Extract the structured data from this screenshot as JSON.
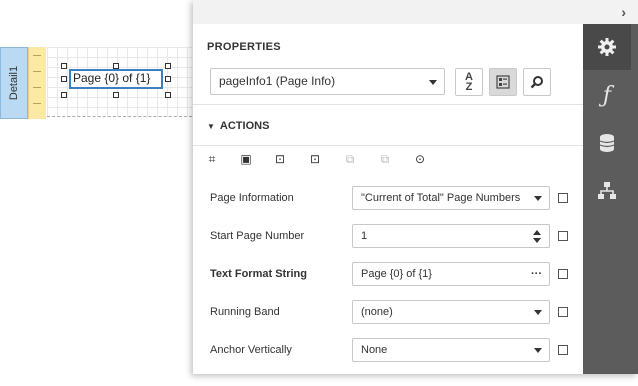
{
  "designer": {
    "band_label": "Detail1",
    "control_text": "Page {0} of {1}"
  },
  "panel": {
    "collapse_icon": "chevron-right-icon",
    "title": "PROPERTIES",
    "component_selector": "pageInfo1 (Page Info)",
    "toolbar": {
      "sort_icon": "sort-az-icon",
      "categories_icon": "categories-icon",
      "search_icon": "search-icon"
    },
    "actions_header": "ACTIONS",
    "action_icons": [
      "fit-bounds-icon",
      "fit-to-content-icon",
      "align-left-icon",
      "align-center-icon",
      "align-disabled-icon",
      "align-disabled-icon",
      "center-icon"
    ],
    "properties": [
      {
        "label": "Page Information",
        "value": "\"Current of Total\" Page Numbers",
        "editor": "dropdown",
        "bold": false
      },
      {
        "label": "Start Page Number",
        "value": "1",
        "editor": "spinner",
        "bold": false
      },
      {
        "label": "Text Format String",
        "value": "Page {0} of {1}",
        "editor": "ellipsis",
        "ellipsis_text": "···",
        "bold": true
      },
      {
        "label": "Running Band",
        "value": "(none)",
        "editor": "dropdown",
        "bold": false
      },
      {
        "label": "Anchor Vertically",
        "value": "None",
        "editor": "dropdown",
        "bold": false
      }
    ]
  },
  "sidebar": {
    "items": [
      {
        "name": "properties-tab",
        "icon": "gear-icon",
        "active": true
      },
      {
        "name": "expressions-tab",
        "icon": "function-icon",
        "active": false
      },
      {
        "name": "field-list-tab",
        "icon": "database-icon",
        "active": false
      },
      {
        "name": "report-explorer-tab",
        "icon": "hierarchy-icon",
        "active": false
      }
    ]
  }
}
